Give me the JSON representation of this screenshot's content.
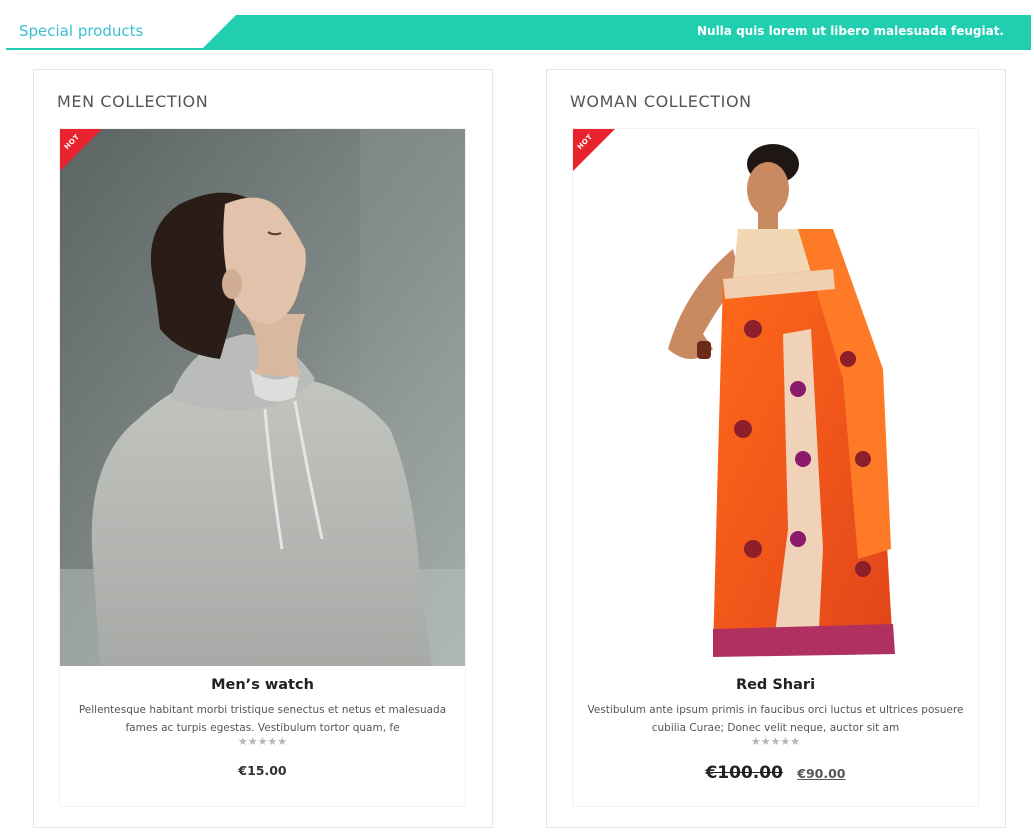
{
  "header": {
    "title": "Special products",
    "tagline": "Nulla quis lorem ut libero malesuada feugiat."
  },
  "colors": {
    "accent": "#1fcfb0",
    "title": "#3bbfd3",
    "hot": "#e8232d"
  },
  "collections": [
    {
      "heading": "MEN COLLECTION",
      "badge": "HOT",
      "product": {
        "name": "Men’s watch",
        "description": "Pellentesque habitant morbi tristique senectus et netus et malesuada fames ac turpis egestas. Vestibulum tortor quam, fe",
        "rating": "★★★★★",
        "price": "€15.00"
      }
    },
    {
      "heading": "WOMAN COLLECTION",
      "badge": "HOT",
      "product": {
        "name": "Red Shari",
        "description": "Vestibulum ante ipsum primis in faucibus orci luctus et ultrices posuere cubilia Curae; Donec velit neque, auctor sit am",
        "rating": "★★★★★",
        "old_price": "€100.00",
        "price": "€90.00"
      }
    }
  ]
}
